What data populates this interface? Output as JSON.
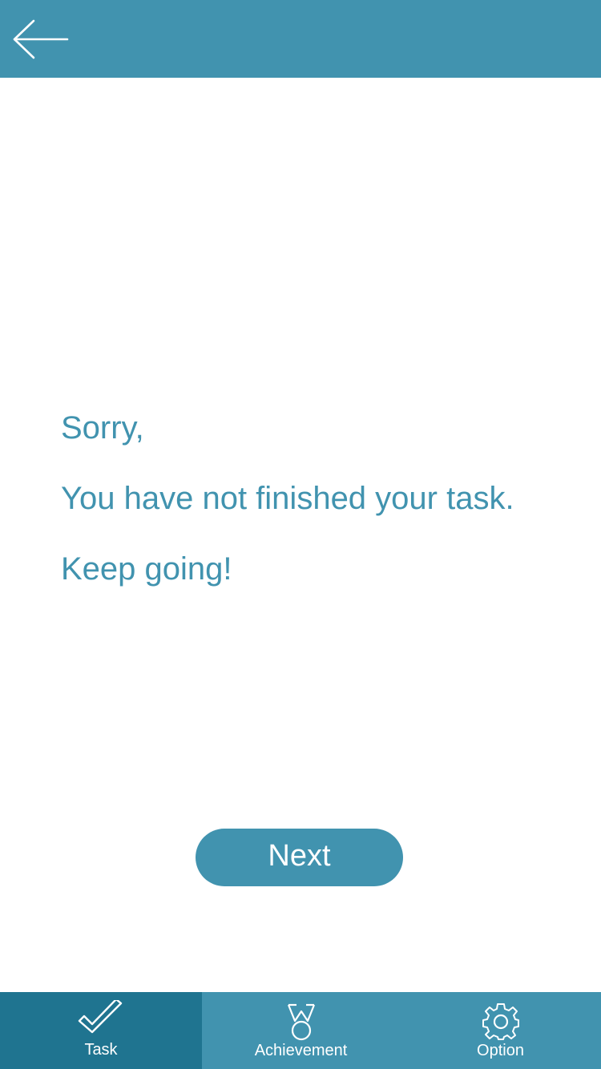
{
  "colors": {
    "primary": "#4193af",
    "active_tab": "#1f7490",
    "background": "#ffffff",
    "on_primary": "#ffffff"
  },
  "header": {
    "back_icon": "arrow-left-icon"
  },
  "message": {
    "line1": "Sorry,",
    "line2": "You have not finished your task.",
    "line3": "Keep going!"
  },
  "next_button": {
    "label": "Next"
  },
  "tabbar": {
    "active": "Task",
    "tabs": [
      {
        "label": "Task",
        "icon": "checkmark-icon"
      },
      {
        "label": "Achievement",
        "icon": "medal-icon"
      },
      {
        "label": "Option",
        "icon": "gear-icon"
      }
    ]
  }
}
